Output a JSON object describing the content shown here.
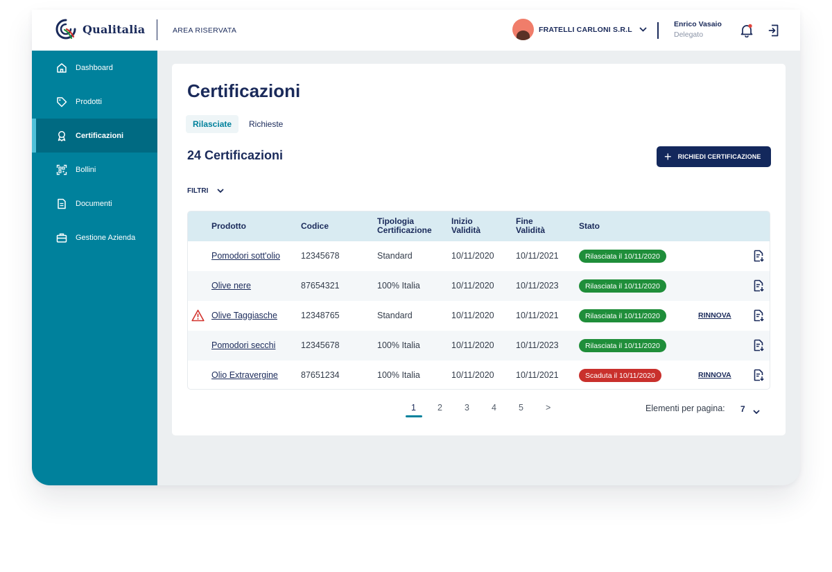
{
  "header": {
    "logo_text": "Qualitalia",
    "area_label": "AREA RISERVATA",
    "company": "FRATELLI CARLONI S.R.L",
    "user_name": "Enrico Vasaio",
    "user_role": "Delegato"
  },
  "sidebar": {
    "items": [
      {
        "label": "Dashboard",
        "icon": "home-icon"
      },
      {
        "label": "Prodotti",
        "icon": "tag-icon"
      },
      {
        "label": "Certificazioni",
        "icon": "award-icon",
        "active": true
      },
      {
        "label": "Bollini",
        "icon": "qr-code-icon"
      },
      {
        "label": "Documenti",
        "icon": "document-icon"
      },
      {
        "label": "Gestione Azienda",
        "icon": "briefcase-icon"
      }
    ]
  },
  "main": {
    "title": "Certificazioni",
    "tabs": [
      {
        "label": "Rilasciate",
        "active": true
      },
      {
        "label": "Richieste",
        "active": false
      }
    ],
    "count_label": "24 Certificazioni",
    "request_button": "RICHIEDI CERTIFICAZIONE",
    "filters_label": "FILTRI"
  },
  "table": {
    "headers": {
      "product": "Prodotto",
      "code": "Codice",
      "type_1": "Tipologia",
      "type_2": "Certificazione",
      "start_1": "Inizio",
      "start_2": "Validità",
      "end_1": "Fine",
      "end_2": "Validità",
      "status": "Stato"
    },
    "rows": [
      {
        "product": "Pomodori sott'olio",
        "code": "12345678",
        "type": "Standard",
        "start": "10/11/2020",
        "end": "10/11/2021",
        "status": "Rilasciata il 10/11/2020",
        "status_color": "#1f8e3a",
        "renew": "",
        "warning": false
      },
      {
        "product": "Olive nere",
        "code": "87654321",
        "type": "100% Italia",
        "start": "10/11/2020",
        "end": "10/11/2023",
        "status": "Rilasciata il 10/11/2020",
        "status_color": "#1f8e3a",
        "renew": "",
        "warning": false
      },
      {
        "product": "Olive Taggiasche",
        "code": "12348765",
        "type": "Standard",
        "start": "10/11/2020",
        "end": "10/11/2021",
        "status": "Rilasciata il 10/11/2020",
        "status_color": "#1f8e3a",
        "renew": "RINNOVA",
        "warning": true
      },
      {
        "product": "Pomodori secchi",
        "code": "12345678",
        "type": "100% Italia",
        "start": "10/11/2020",
        "end": "10/11/2023",
        "status": "Rilasciata il 10/11/2020",
        "status_color": "#1f8e3a",
        "renew": "",
        "warning": false
      },
      {
        "product": "Olio Extravergine",
        "code": "87651234",
        "type": "100% Italia",
        "start": "10/11/2020",
        "end": "10/11/2021",
        "status": "Scaduta il 10/11/2020",
        "status_color": "#c9302c",
        "renew": "RINNOVA",
        "warning": false
      }
    ]
  },
  "pagination": {
    "pages": [
      "1",
      "2",
      "3",
      "4",
      "5",
      ">"
    ],
    "current": "1",
    "per_page_label": "Elementi per pagina:",
    "per_page_value": "7"
  },
  "colors": {
    "primary": "#00819c",
    "navy": "#1a2a5a",
    "success": "#1f8e3a",
    "danger": "#c9302c"
  }
}
